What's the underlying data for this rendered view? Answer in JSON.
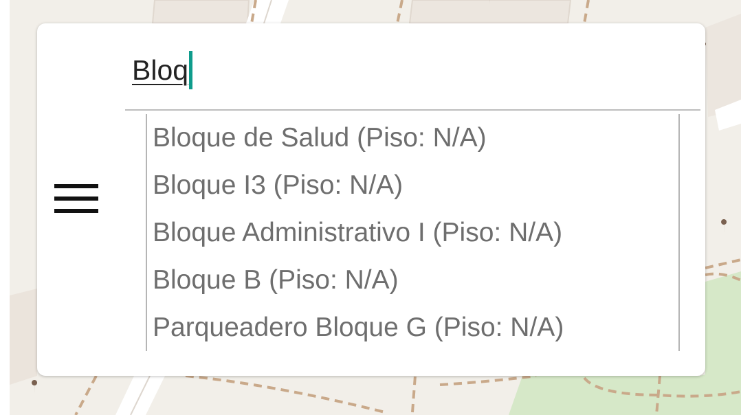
{
  "search": {
    "query": "Bloq",
    "suggestions": [
      "Bloque de Salud (Piso: N/A)",
      "Bloque I3 (Piso: N/A)",
      "Bloque Administrativo I (Piso: N/A)",
      "Bloque B (Piso: N/A)",
      "Parqueadero Bloque G (Piso: N/A)"
    ]
  },
  "menu": {
    "icon": "hamburger-menu-icon"
  },
  "colors": {
    "map_background": "#f2efe9",
    "map_road": "#ffffff",
    "map_path": "#c9a98a",
    "map_park": "#d6e8c8",
    "caret": "#0f9c8c",
    "suggestion_text": "#6e6e6e"
  }
}
